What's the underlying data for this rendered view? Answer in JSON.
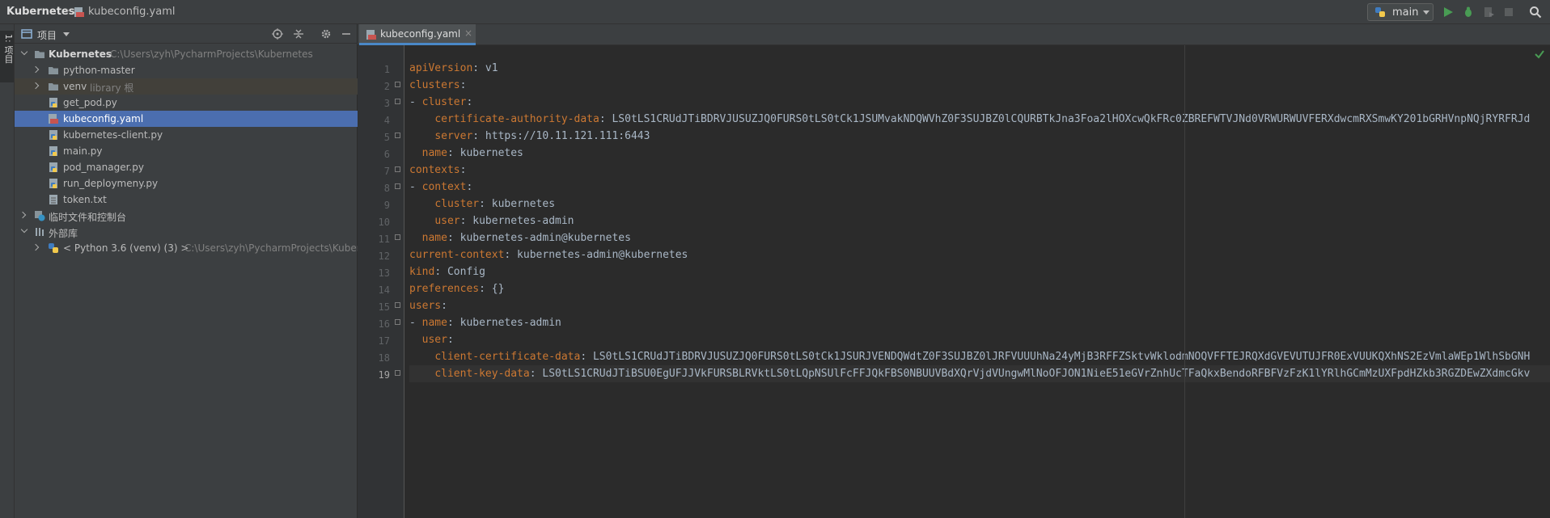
{
  "nav": {
    "project": "Kubernetes",
    "file": "kubeconfig.yaml",
    "run_config": "main"
  },
  "sidebar_strip": {
    "label": "1: 项目"
  },
  "project_panel": {
    "title": "项目",
    "tree": [
      {
        "label": "Kubernetes",
        "hint": "C:\\Users\\zyh\\PycharmProjects\\Kubernetes"
      },
      {
        "label": "python-master",
        "hint": ""
      },
      {
        "label": "venv",
        "hint": "library 根"
      },
      {
        "label": "get_pod.py",
        "hint": ""
      },
      {
        "label": "kubeconfig.yaml",
        "hint": ""
      },
      {
        "label": "kubernetes-client.py",
        "hint": ""
      },
      {
        "label": "main.py",
        "hint": ""
      },
      {
        "label": "pod_manager.py",
        "hint": ""
      },
      {
        "label": "run_deploymeny.py",
        "hint": ""
      },
      {
        "label": "token.txt",
        "hint": ""
      },
      {
        "label": "临时文件和控制台",
        "hint": ""
      },
      {
        "label": "外部库",
        "hint": ""
      },
      {
        "label": "< Python 3.6 (venv) (3) >",
        "hint": "C:\\Users\\zyh\\PycharmProjects\\Kuber"
      }
    ]
  },
  "editor": {
    "tab_label": "kubeconfig.yaml",
    "tab_close": "×",
    "line_numbers": [
      "1",
      "2",
      "3",
      "4",
      "5",
      "6",
      "7",
      "8",
      "9",
      "10",
      "11",
      "12",
      "13",
      "14",
      "15",
      "16",
      "17",
      "18",
      "19"
    ],
    "lines": [
      {
        "indent": "",
        "key": "apiVersion",
        "value": ": v1"
      },
      {
        "indent": "",
        "key": "clusters",
        "value": ":"
      },
      {
        "indent": "- ",
        "key": "cluster",
        "value": ":"
      },
      {
        "indent": "    ",
        "key": "certificate-authority-data",
        "value": ": LS0tLS1CRUdJTiBDRVJUSUZJQ0FURS0tLS0tCk1JSUMvakNDQWVhZ0F3SUJBZ0lCQURBTkJna3Foa2lHOXcwQkFRc0ZBREFWTVJNd0VRWURWUVFERXdwcmRXSmwKY201bGRHVnpNQjRYRFRJd"
      },
      {
        "indent": "    ",
        "key": "server",
        "value": ": https://10.11.121.111:6443"
      },
      {
        "indent": "  ",
        "key": "name",
        "value": ": kubernetes"
      },
      {
        "indent": "",
        "key": "contexts",
        "value": ":"
      },
      {
        "indent": "- ",
        "key": "context",
        "value": ":"
      },
      {
        "indent": "    ",
        "key": "cluster",
        "value": ": kubernetes"
      },
      {
        "indent": "    ",
        "key": "user",
        "value": ": kubernetes-admin"
      },
      {
        "indent": "  ",
        "key": "name",
        "value": ": kubernetes-admin@kubernetes"
      },
      {
        "indent": "",
        "key": "current-context",
        "value": ": kubernetes-admin@kubernetes"
      },
      {
        "indent": "",
        "key": "kind",
        "value": ": Config"
      },
      {
        "indent": "",
        "key": "preferences",
        "value": ": {}"
      },
      {
        "indent": "",
        "key": "users",
        "value": ":"
      },
      {
        "indent": "- ",
        "key": "name",
        "value": ": kubernetes-admin"
      },
      {
        "indent": "  ",
        "key": "user",
        "value": ":"
      },
      {
        "indent": "    ",
        "key": "client-certificate-data",
        "value": ": LS0tLS1CRUdJTiBDRVJUSUZJQ0FURS0tLS0tCk1JSURJVENDQWdtZ0F3SUJBZ0lJRFVUUUhNa24yMjB3RFFZSktvWklodmNOQVFFTEJRQXdGVEVUTUJFR0ExVUUKQXhNS2EzVmlaWEp1WlhSbGNH"
      },
      {
        "indent": "    ",
        "key": "client-key-data",
        "value": ": LS0tLS1CRUdJTiBSU0EgUFJJVkFURSBLRVktLS0tLQpNSUlFcFFJQkFBS0NBUUVBdXQrVjdVUngwMlNoOFJON1NieE51eGVrZnhUcTFaQkxBendoRFBFVzFzK1lYRlhGCmMzUXFpdHZkb3RGZDEwZXdmcGkv"
      }
    ]
  },
  "colors": {
    "key": "#cc7832",
    "value": "#a9b7c6",
    "selection": "#4b6eaf",
    "panel": "#3c3f41",
    "editor_bg": "#2b2b2b"
  }
}
